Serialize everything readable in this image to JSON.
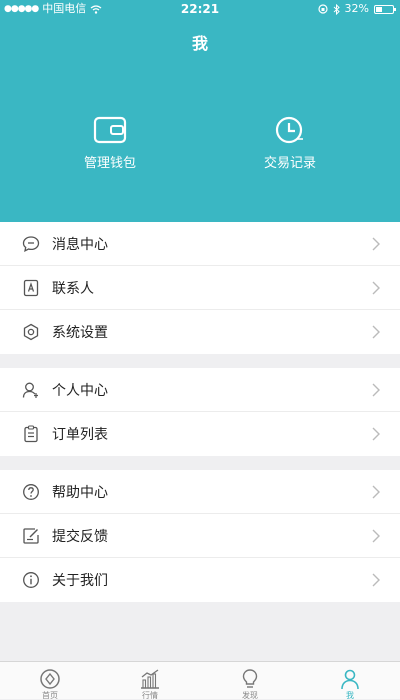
{
  "status_bar": {
    "carrier": "中国电信",
    "time": "22:21",
    "battery": "32%"
  },
  "header": {
    "title": "我",
    "actions": [
      {
        "label": "管理钱包",
        "icon": "wallet-icon"
      },
      {
        "label": "交易记录",
        "icon": "clock-icon"
      }
    ]
  },
  "menu": {
    "group1": [
      {
        "label": "消息中心",
        "icon": "message-icon"
      },
      {
        "label": "联系人",
        "icon": "contacts-icon"
      },
      {
        "label": "系统设置",
        "icon": "settings-icon"
      }
    ],
    "group2": [
      {
        "label": "个人中心",
        "icon": "user-icon"
      },
      {
        "label": "订单列表",
        "icon": "order-list-icon"
      }
    ],
    "group3": [
      {
        "label": "帮助中心",
        "icon": "help-icon"
      },
      {
        "label": "提交反馈",
        "icon": "feedback-icon"
      },
      {
        "label": "关于我们",
        "icon": "info-icon"
      }
    ]
  },
  "tabbar": {
    "tabs": [
      {
        "label": "首页",
        "icon": "home-icon"
      },
      {
        "label": "行情",
        "icon": "market-chart-icon"
      },
      {
        "label": "发现",
        "icon": "discover-icon"
      },
      {
        "label": "我",
        "icon": "profile-icon",
        "active": true
      }
    ]
  },
  "colors": {
    "accent": "#3ab7c3",
    "background": "#efeff1",
    "tab_inactive": "#888888"
  }
}
